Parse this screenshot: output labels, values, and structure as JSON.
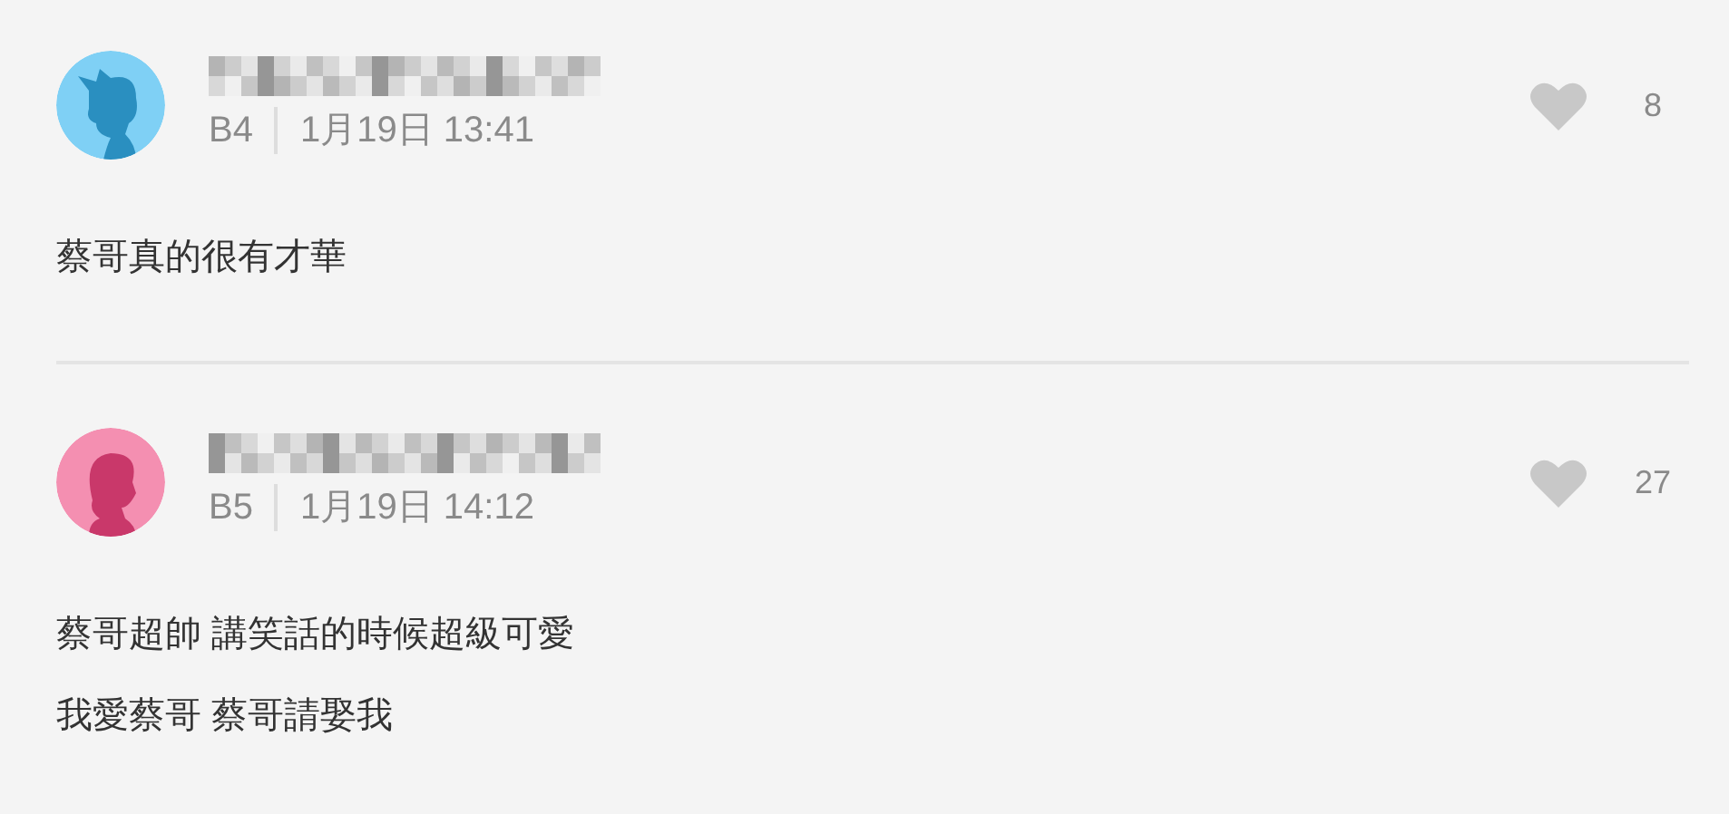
{
  "comments": [
    {
      "avatar": {
        "kind": "boy",
        "color": "#7fd0f5"
      },
      "floor": "B4",
      "time": "1月19日 13:41",
      "likes": "8",
      "liked": false,
      "lines": [
        "蔡哥真的很有才華"
      ]
    },
    {
      "avatar": {
        "kind": "girl",
        "color": "#f48fb1"
      },
      "floor": "B5",
      "time": "1月19日 14:12",
      "likes": "27",
      "liked": false,
      "lines": [
        "蔡哥超帥 講笑話的時候超級可愛",
        "我愛蔡哥 蔡哥請娶我"
      ]
    }
  ]
}
